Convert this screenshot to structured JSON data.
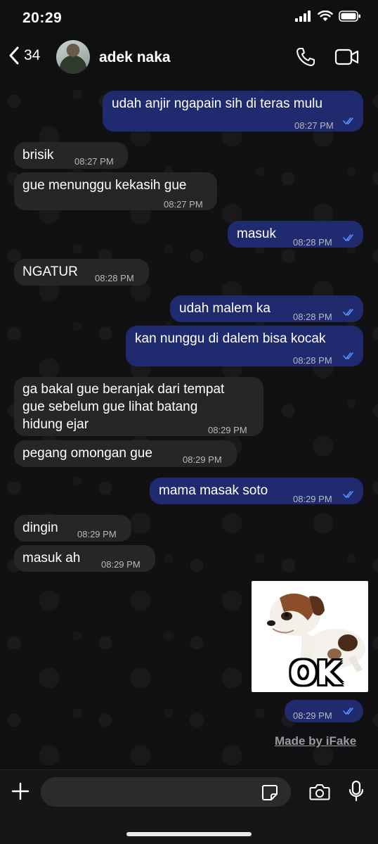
{
  "status_bar": {
    "time": "20:29"
  },
  "header": {
    "back_count": "34",
    "contact_name": "adek naka"
  },
  "messages": [
    {
      "dir": "out",
      "text": "udah anjir ngapain sih di teras mulu",
      "time": "08:27 PM"
    },
    {
      "dir": "in",
      "text": "brisik",
      "time": "08:27 PM"
    },
    {
      "dir": "in",
      "text": "gue menunggu kekasih gue",
      "time": "08:27 PM"
    },
    {
      "dir": "out",
      "text": "masuk",
      "time": "08:28 PM"
    },
    {
      "dir": "in",
      "text": "NGATUR",
      "time": "08:28 PM"
    },
    {
      "dir": "out",
      "text": "udah malem ka",
      "time": "08:28 PM"
    },
    {
      "dir": "out",
      "text": "kan nunggu di dalem bisa kocak",
      "time": "08:28 PM"
    },
    {
      "dir": "in",
      "lines": [
        "ga bakal gue beranjak dari tempat",
        "gue sebelum gue lihat batang",
        "hidung ejar"
      ],
      "time": "08:29 PM"
    },
    {
      "dir": "in",
      "text": "pegang omongan gue",
      "time": "08:29 PM"
    },
    {
      "dir": "out",
      "text": "mama masak soto",
      "time": "08:29 PM"
    },
    {
      "dir": "in",
      "text": "dingin",
      "time": "08:29 PM"
    },
    {
      "dir": "in",
      "text": "masuk ah",
      "time": "08:29 PM"
    },
    {
      "dir": "out",
      "type": "sticker",
      "sticker_text": "OK",
      "time": "08:29 PM"
    }
  ],
  "watermark": "Made by iFake",
  "composer": {
    "placeholder": ""
  },
  "colors": {
    "outgoing_bubble": "#202a6e",
    "incoming_bubble": "#262626",
    "read_ticks": "#5b8ff9"
  },
  "icons": [
    "back-chevron-icon",
    "phone-icon",
    "video-camera-icon",
    "plus-icon",
    "sticker-icon",
    "camera-icon",
    "microphone-icon",
    "double-check-icon"
  ]
}
